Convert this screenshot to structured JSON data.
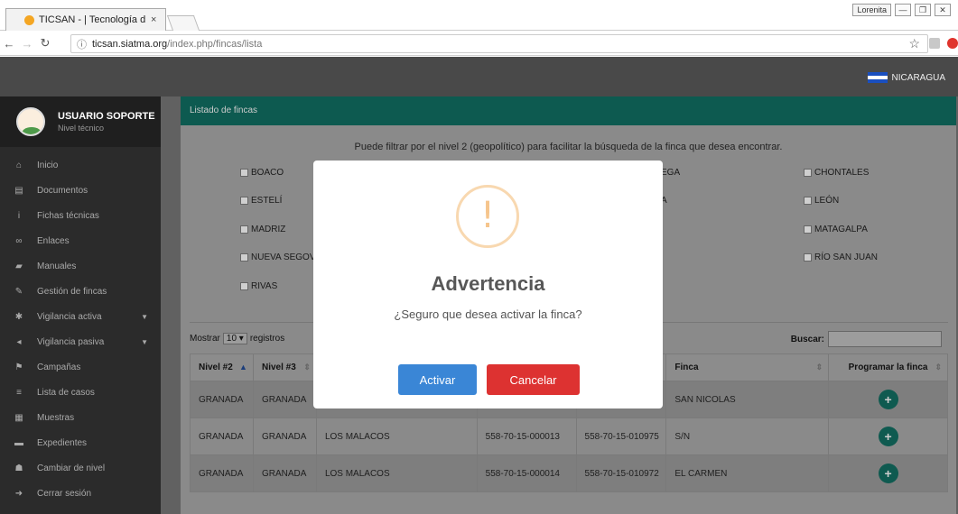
{
  "browser": {
    "tab_title": "TICSAN - | Tecnología de",
    "tab_close": "×",
    "user_badge": "Lorenita",
    "url_host": "ticsan.siatma.org",
    "url_path": "/index.php/fincas/lista"
  },
  "header": {
    "country": "NICARAGUA"
  },
  "user": {
    "name": "USUARIO SOPORTE",
    "role": "Nivel técnico"
  },
  "sidebar": {
    "items": [
      {
        "label": "Inicio",
        "icon": "home-icon"
      },
      {
        "label": "Documentos",
        "icon": "document-icon"
      },
      {
        "label": "Fichas técnicas",
        "icon": "info-icon"
      },
      {
        "label": "Enlaces",
        "icon": "link-icon"
      },
      {
        "label": "Manuales",
        "icon": "book-icon"
      },
      {
        "label": "Gestión de fincas",
        "icon": "edit-icon"
      },
      {
        "label": "Vigilancia activa",
        "icon": "bug-icon"
      },
      {
        "label": "Vigilancia pasiva",
        "icon": "megaphone-icon"
      },
      {
        "label": "Campañas",
        "icon": "flag-icon"
      },
      {
        "label": "Lista de casos",
        "icon": "list-icon"
      },
      {
        "label": "Muestras",
        "icon": "sample-icon"
      },
      {
        "label": "Expedientes",
        "icon": "folder-icon"
      },
      {
        "label": "Cambiar de nivel",
        "icon": "users-icon"
      },
      {
        "label": "Cerrar sesión",
        "icon": "logout-icon"
      }
    ]
  },
  "panel": {
    "title": "Listado de fincas",
    "hint": "Puede filtrar por el nivel 2 (geopolítico) para facilitar la búsqueda de la finca que desea encontrar.",
    "filters": [
      "BOACO",
      "ESTELÍ",
      "MADRIZ",
      "NUEVA SEGOVI",
      "RIVAS",
      "EGA",
      "A",
      "CHONTALES",
      "LEÓN",
      "MATAGALPA",
      "RÍO SAN JUAN"
    ],
    "length_prefix": "Mostrar",
    "length_value": "10",
    "length_suffix": "registros",
    "search_label": "Buscar:"
  },
  "table": {
    "columns": [
      "Nivel #2",
      "Nivel #3",
      "",
      "",
      "",
      "Finca",
      "Programar la finca"
    ],
    "rows": [
      [
        "GRANADA",
        "GRANADA",
        "",
        "",
        "",
        "SAN NICOLAS"
      ],
      [
        "GRANADA",
        "GRANADA",
        "LOS MALACOS",
        "558-70-15-000013",
        "558-70-15-010975",
        "S/N"
      ],
      [
        "GRANADA",
        "GRANADA",
        "LOS MALACOS",
        "558-70-15-000014",
        "558-70-15-010972",
        "EL CARMEN"
      ]
    ]
  },
  "modal": {
    "icon": "!",
    "title": "Advertencia",
    "text": "¿Seguro que desea activar la finca?",
    "confirm": "Activar",
    "cancel": "Cancelar",
    "confirm_color": "#3a86d6",
    "cancel_color": "#dd3231"
  }
}
